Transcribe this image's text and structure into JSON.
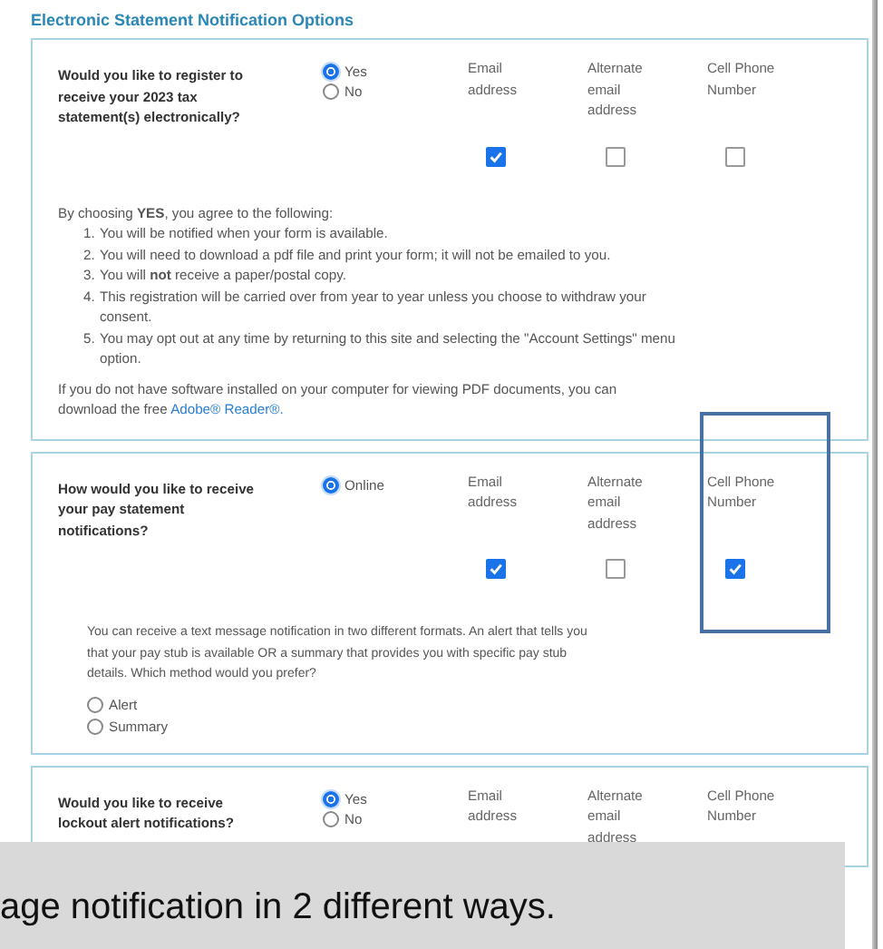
{
  "heading": "Electronic Statement Notification Options",
  "sections": [
    {
      "question": "Would you like to register to receive your 2023 tax statement(s) electronically?",
      "radios": [
        {
          "label": "Yes",
          "selected": true
        },
        {
          "label": "No",
          "selected": false
        }
      ],
      "channels": [
        {
          "label": "Email address",
          "checked": true
        },
        {
          "label": "Alternate email address",
          "checked": false
        },
        {
          "label": "Cell Phone Number",
          "checked": false
        }
      ],
      "intro": "By choosing **YES**, you agree to the following:",
      "list": [
        {
          "marker": "1.",
          "text": "You will be notified when your form is available."
        },
        {
          "marker": "2.",
          "text": "You will need to download a pdf file and print your form; it will not be emailed to you."
        },
        {
          "marker": "3.",
          "text": "You will **not** receive a paper/postal copy."
        },
        {
          "marker": "4.",
          "text": "This registration will be carried over from year to year unless you choose to withdraw your consent."
        },
        {
          "marker": "5.",
          "text": "You may opt out at any time by returning to this site and selecting the \"Account Settings\" menu option."
        }
      ],
      "note": "If you do not have software installed on your computer for viewing PDF documents, you can download the free",
      "link": "Adobe® Reader®."
    },
    {
      "question": "How would you like to receive your pay statement notifications?",
      "radios": [
        {
          "label": "Online",
          "selected": true
        }
      ],
      "channels": [
        {
          "label": "Email address",
          "checked": true
        },
        {
          "label": "Alternate email address",
          "checked": false
        },
        {
          "label": "Cell Phone Number",
          "checked": true
        }
      ],
      "sms_note": "You can receive a text message notification in two different formats. An alert that tells you that your pay stub is available OR a summary that provides you with specific pay stub details. Which method would you prefer?",
      "formats": [
        {
          "label": "Alert",
          "selected": false
        },
        {
          "label": "Summary",
          "selected": false
        }
      ]
    },
    {
      "question": "Would you like to receive lockout alert notifications?",
      "radios": [
        {
          "label": "Yes",
          "selected": true
        },
        {
          "label": "No",
          "selected": false
        }
      ],
      "channels": [
        {
          "label": "Email address"
        },
        {
          "label": "Alternate email address"
        },
        {
          "label": "Cell Phone Number"
        }
      ]
    }
  ],
  "caption": "age notification in 2 different ways."
}
